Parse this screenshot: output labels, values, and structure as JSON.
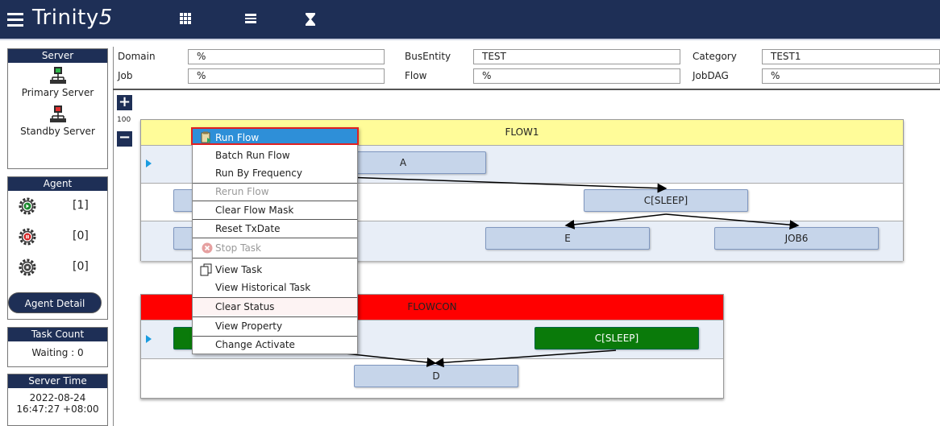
{
  "app": {
    "name": "Trinity",
    "name_num": "5"
  },
  "toolbar": {
    "icons": [
      "grid-icon",
      "list-icon",
      "hourglass-icon"
    ]
  },
  "server": {
    "header": "Server",
    "primary_label": "Primary Server",
    "standby_label": "Standby Server"
  },
  "agent": {
    "header": "Agent",
    "running": "[1]",
    "stopped": "[0]",
    "idle": "[0]",
    "detail_button": "Agent Detail"
  },
  "task_count": {
    "header": "Task Count",
    "waiting": "Waiting : 0"
  },
  "server_time": {
    "header": "Server Time",
    "date": "2022-08-24",
    "time": "16:47:27 +08:00"
  },
  "filters": {
    "domain_label": "Domain",
    "domain_value": "%",
    "busentity_label": "BusEntity",
    "busentity_value": "TEST",
    "category_label": "Category",
    "category_value": "TEST1",
    "job_label": "Job",
    "job_value": "%",
    "flow_label": "Flow",
    "flow_value": "%",
    "jobdag_label": "JobDAG",
    "jobdag_value": "%"
  },
  "zoom": {
    "plus": "+",
    "minus": "−",
    "value": "100"
  },
  "flow1": {
    "title": "FLOW1",
    "header_color": "#fffc99",
    "jobs": [
      "A",
      "C[SLEEP]",
      "E",
      "JOB6"
    ]
  },
  "flowcon": {
    "title": "FLOWCON",
    "header_color": "#ff0000",
    "jobs": [
      "C[SLEEP]",
      "D"
    ]
  },
  "context_menu": {
    "items": [
      "Run Flow",
      "Batch Run Flow",
      "Run By Frequency",
      "Rerun Flow",
      "Clear Flow Mask",
      "Reset TxDate",
      "Stop Task",
      "View Task",
      "View Historical Task",
      "Clear Status",
      "View Property",
      "Change Activate"
    ]
  }
}
